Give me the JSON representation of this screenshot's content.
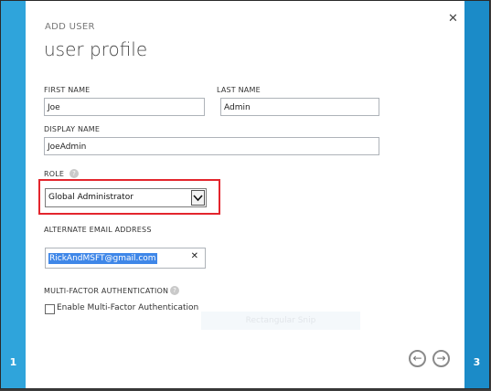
{
  "wizard": {
    "eyebrow": "ADD USER",
    "title": "user profile",
    "close_icon": "✕",
    "step_left": "1",
    "step_right": "3"
  },
  "form": {
    "first_name": {
      "label": "FIRST NAME",
      "value": "Joe"
    },
    "last_name": {
      "label": "LAST NAME",
      "value": "Admin"
    },
    "display_name": {
      "label": "DISPLAY NAME",
      "value": "JoeAdmin"
    },
    "role": {
      "label": "ROLE",
      "value": "Global Administrator",
      "help": "?"
    },
    "alternate_email": {
      "label": "ALTERNATE EMAIL ADDRESS",
      "value": "RickAndMSFT@gmail.com",
      "clear_icon": "✕"
    },
    "mfa": {
      "label": "MULTI-FACTOR AUTHENTICATION",
      "help": "?",
      "checkbox_label": "Enable Multi-Factor Authentication",
      "checked": false
    }
  },
  "ghost_text": "Rectangular Snip",
  "nav": {
    "back_icon": "←",
    "next_icon": "→"
  },
  "colors": {
    "accent": "#2fa4db",
    "highlight_border": "#e3252d",
    "selection": "#3f87e8"
  }
}
